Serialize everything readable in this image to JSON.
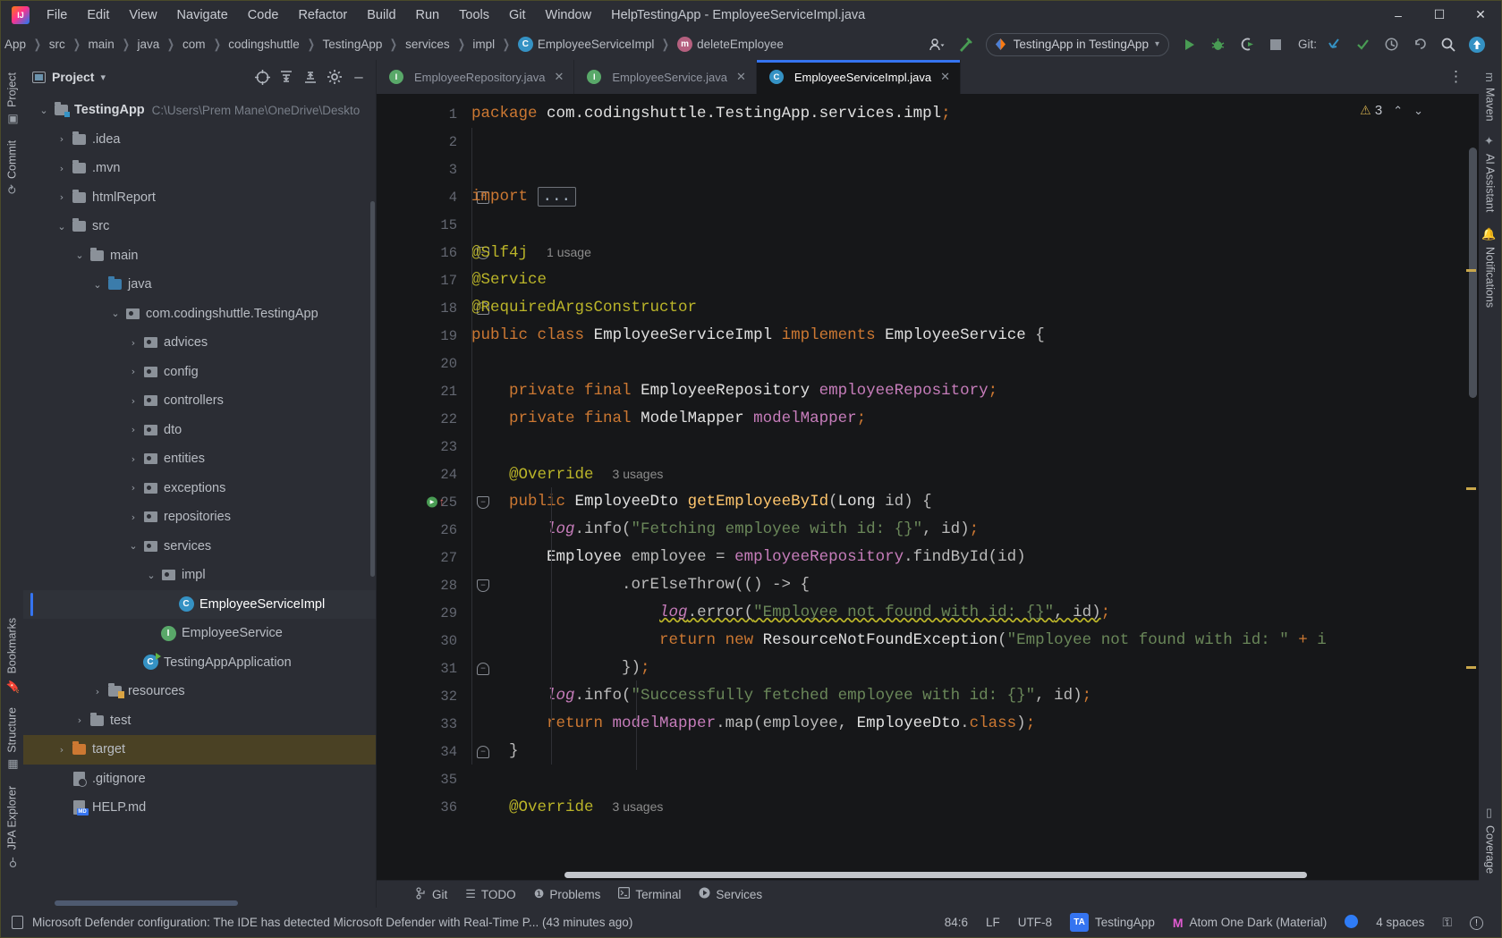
{
  "window": {
    "title": "TestingApp - EmployeeServiceImpl.java",
    "minimize": "–",
    "maximize": "☐",
    "close": "✕"
  },
  "menu": {
    "items": [
      "File",
      "Edit",
      "View",
      "Navigate",
      "Code",
      "Refactor",
      "Build",
      "Run",
      "Tools",
      "Git",
      "Window",
      "Help"
    ]
  },
  "breadcrumb": {
    "items": [
      {
        "label": "App",
        "icon": ""
      },
      {
        "label": "src",
        "icon": ""
      },
      {
        "label": "main",
        "icon": ""
      },
      {
        "label": "java",
        "icon": ""
      },
      {
        "label": "com",
        "icon": ""
      },
      {
        "label": "codingshuttle",
        "icon": ""
      },
      {
        "label": "TestingApp",
        "icon": ""
      },
      {
        "label": "services",
        "icon": ""
      },
      {
        "label": "impl",
        "icon": ""
      },
      {
        "label": "EmployeeServiceImpl",
        "icon": "class-badge"
      },
      {
        "label": "deleteEmployee",
        "icon": "method-badge"
      }
    ],
    "separator": "❯"
  },
  "toolbar": {
    "user_icon": "user-icon",
    "user_caret": "▾",
    "build_icon": "hammer-icon",
    "run_config": {
      "label": "TestingApp in TestingApp",
      "caret": "▾",
      "icon": "intellij-run-icon"
    },
    "run_label": "▶",
    "debug_label": "debug-bug-icon",
    "coverage_label": "run-with-coverage-icon",
    "stop_label": "■",
    "git_label": "Git:",
    "git_update": "↙",
    "git_commit": "✓",
    "git_history": "◷",
    "git_rollback": "↶",
    "search": "⚲",
    "updates": "⬆"
  },
  "left_strip": {
    "tabs": [
      {
        "label": "Project",
        "icon": "project-icon"
      },
      {
        "label": "Commit",
        "icon": "commit-icon"
      },
      {
        "label": "Bookmarks",
        "icon": "bookmark-icon"
      },
      {
        "label": "Structure",
        "icon": "structure-icon"
      },
      {
        "label": "JPA Explorer",
        "icon": "jpa-icon"
      }
    ]
  },
  "right_strip": {
    "tabs": [
      {
        "label": "Maven",
        "icon": "maven-icon"
      },
      {
        "label": "AI Assistant",
        "icon": "ai-icon"
      },
      {
        "label": "Notifications",
        "icon": "bell-icon"
      },
      {
        "label": "Coverage",
        "icon": "coverage-icon"
      }
    ]
  },
  "project_panel": {
    "title": "Project",
    "title_caret": "▾",
    "actions": [
      {
        "name": "select-opened-file-icon",
        "glyph": "⊕"
      },
      {
        "name": "expand-all-icon",
        "glyph": "⩝"
      },
      {
        "name": "collapse-all-icon",
        "glyph": "⩞"
      },
      {
        "name": "settings-gear-icon",
        "glyph": "⚙"
      },
      {
        "name": "hide-panel-icon",
        "glyph": "–"
      }
    ],
    "tree": [
      {
        "label": "TestingApp",
        "path": "C:\\Users\\Prem Mane\\OneDrive\\Deskto",
        "indent": 0,
        "chevron": "⌄",
        "icon": "module-folder",
        "bold": true
      },
      {
        "label": ".idea",
        "indent": 1,
        "chevron": "›",
        "icon": "folder"
      },
      {
        "label": ".mvn",
        "indent": 1,
        "chevron": "›",
        "icon": "folder"
      },
      {
        "label": "htmlReport",
        "indent": 1,
        "chevron": "›",
        "icon": "folder"
      },
      {
        "label": "src",
        "indent": 1,
        "chevron": "⌄",
        "icon": "folder"
      },
      {
        "label": "main",
        "indent": 2,
        "chevron": "⌄",
        "icon": "folder"
      },
      {
        "label": "java",
        "indent": 3,
        "chevron": "⌄",
        "icon": "folder-blue"
      },
      {
        "label": "com.codingshuttle.TestingApp",
        "indent": 4,
        "chevron": "⌄",
        "icon": "package"
      },
      {
        "label": "advices",
        "indent": 5,
        "chevron": "›",
        "icon": "package"
      },
      {
        "label": "config",
        "indent": 5,
        "chevron": "›",
        "icon": "package"
      },
      {
        "label": "controllers",
        "indent": 5,
        "chevron": "›",
        "icon": "package"
      },
      {
        "label": "dto",
        "indent": 5,
        "chevron": "›",
        "icon": "package"
      },
      {
        "label": "entities",
        "indent": 5,
        "chevron": "›",
        "icon": "package"
      },
      {
        "label": "exceptions",
        "indent": 5,
        "chevron": "›",
        "icon": "package"
      },
      {
        "label": "repositories",
        "indent": 5,
        "chevron": "›",
        "icon": "package"
      },
      {
        "label": "services",
        "indent": 5,
        "chevron": "⌄",
        "icon": "package"
      },
      {
        "label": "impl",
        "indent": 6,
        "chevron": "⌄",
        "icon": "package"
      },
      {
        "label": "EmployeeServiceImpl",
        "indent": 7,
        "chevron": "",
        "icon": "class",
        "selected": true
      },
      {
        "label": "EmployeeService",
        "indent": 6,
        "chevron": "",
        "icon": "interface"
      },
      {
        "label": "TestingAppApplication",
        "indent": 5,
        "chevron": "",
        "icon": "class-app"
      },
      {
        "label": "resources",
        "indent": 3,
        "chevron": "›",
        "icon": "folder-resources"
      },
      {
        "label": "test",
        "indent": 2,
        "chevron": "›",
        "icon": "folder"
      },
      {
        "label": "target",
        "indent": 1,
        "chevron": "›",
        "icon": "folder-orange",
        "highlight": true
      },
      {
        "label": ".gitignore",
        "indent": 1,
        "chevron": "",
        "icon": "file-ignored"
      },
      {
        "label": "HELP.md",
        "indent": 1,
        "chevron": "",
        "icon": "file-md"
      }
    ]
  },
  "editor": {
    "tabs": [
      {
        "label": "EmployeeRepository.java",
        "icon": "interface",
        "active": false,
        "close": "✕"
      },
      {
        "label": "EmployeeService.java",
        "icon": "interface",
        "active": false,
        "close": "✕"
      },
      {
        "label": "EmployeeServiceImpl.java",
        "icon": "class",
        "active": true,
        "close": "✕"
      }
    ],
    "tab_overflow": "⋮",
    "warnings": {
      "count": "3",
      "triangle": "⚠",
      "up": "⌃",
      "down": "⌄"
    },
    "line_numbers": [
      "1",
      "2",
      "3",
      "4",
      "15",
      "16",
      "17",
      "18",
      "19",
      "20",
      "21",
      "22",
      "23",
      "24",
      "25",
      "26",
      "27",
      "28",
      "29",
      "30",
      "31",
      "32",
      "33",
      "34",
      "35",
      "36"
    ],
    "code_lines": [
      {
        "n": "1",
        "text": "package com.codingshuttle.TestingApp.services.impl;"
      },
      {
        "n": "2",
        "text": ""
      },
      {
        "n": "3",
        "text": ""
      },
      {
        "n": "4",
        "text": "import ..."
      },
      {
        "n": "15",
        "text": ""
      },
      {
        "n": "16",
        "text": "@Slf4j",
        "usage": "1 usage"
      },
      {
        "n": "17",
        "text": "@Service"
      },
      {
        "n": "18",
        "text": "@RequiredArgsConstructor"
      },
      {
        "n": "19",
        "text": "public class EmployeeServiceImpl implements EmployeeService {"
      },
      {
        "n": "20",
        "text": ""
      },
      {
        "n": "21",
        "text": "    private final EmployeeRepository employeeRepository;"
      },
      {
        "n": "22",
        "text": "    private final ModelMapper modelMapper;"
      },
      {
        "n": "23",
        "text": ""
      },
      {
        "n": "24",
        "text": "    @Override",
        "usage": "3 usages"
      },
      {
        "n": "25",
        "text": "    public EmployeeDto getEmployeeById(Long id) {"
      },
      {
        "n": "26",
        "text": "        log.info(\"Fetching employee with id: {}\", id);"
      },
      {
        "n": "27",
        "text": "        Employee employee = employeeRepository.findById(id)"
      },
      {
        "n": "28",
        "text": "                .orElseThrow(() -> {"
      },
      {
        "n": "29",
        "text": "                    log.error(\"Employee not found with id: {}\", id);"
      },
      {
        "n": "30",
        "text": "                    return new ResourceNotFoundException(\"Employee not found with id: \" + i"
      },
      {
        "n": "31",
        "text": "                });"
      },
      {
        "n": "32",
        "text": "        log.info(\"Successfully fetched employee with id: {}\", id);"
      },
      {
        "n": "33",
        "text": "        return modelMapper.map(employee, EmployeeDto.class);"
      },
      {
        "n": "34",
        "text": "    }"
      },
      {
        "n": "35",
        "text": ""
      },
      {
        "n": "36",
        "text": "    @Override",
        "usage": "3 usages"
      }
    ]
  },
  "bottom_bar": {
    "items": [
      {
        "label": "Git",
        "icon": "git-branch-icon"
      },
      {
        "label": "TODO",
        "icon": "list-icon"
      },
      {
        "label": "Problems",
        "icon": "exclamation-circle-icon"
      },
      {
        "label": "Terminal",
        "icon": "terminal-icon"
      },
      {
        "label": "Services",
        "icon": "play-circle-icon"
      }
    ]
  },
  "status_bar": {
    "message": "Microsoft Defender configuration: The IDE has detected Microsoft Defender with Real-Time P... (43 minutes ago)",
    "message_icon": "notification-icon",
    "caret_position": "84:6",
    "line_separator": "LF",
    "encoding": "UTF-8",
    "project_badge": "TA",
    "project_name": "TestingApp",
    "theme_icon": "M",
    "theme_name": "Atom One Dark (Material)",
    "sync_dot": "blue-dot",
    "indent": "4 spaces",
    "lock_icon": "⚿",
    "inspection_icon": "!"
  },
  "colors": {
    "accent": "#3574f0",
    "editor_bg": "#161719",
    "panel_bg": "#2b2d34",
    "keyword": "#cc7832",
    "annotation": "#bbb529",
    "string": "#6a8759",
    "field": "#c77dbb",
    "method": "#ffc66d",
    "target_highlight": "#4a4124",
    "warning": "#c9a74b"
  }
}
